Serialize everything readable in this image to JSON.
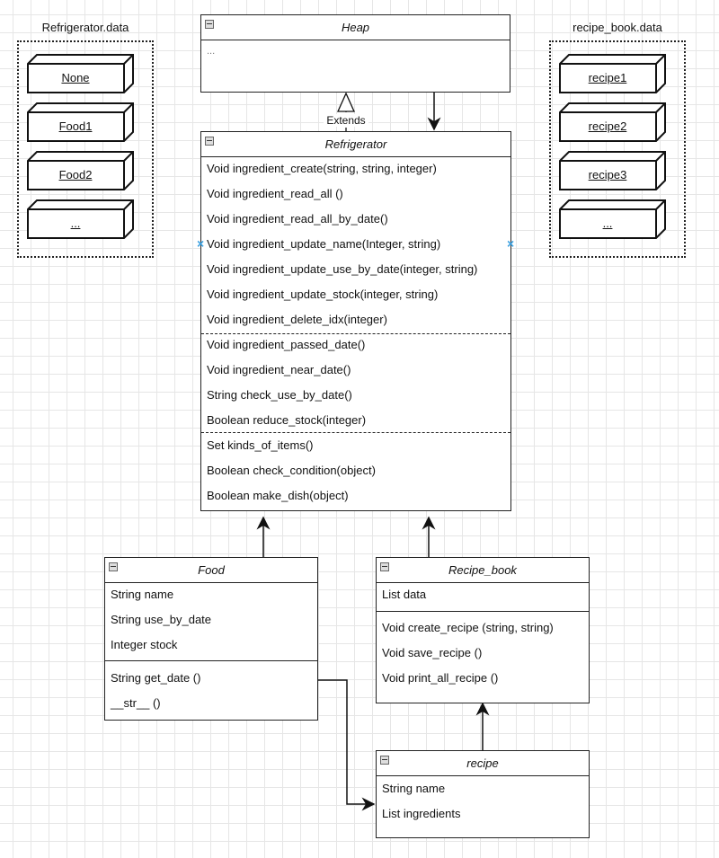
{
  "stores": [
    {
      "label": "Refrigerator.data",
      "items": [
        "None",
        "Food1",
        "Food2",
        "..."
      ]
    },
    {
      "label": "recipe_book.data",
      "items": [
        "recipe1",
        "recipe2",
        "recipe3",
        "..."
      ]
    }
  ],
  "classes": {
    "heap": {
      "name": "Heap",
      "rows": [
        "..."
      ]
    },
    "refrigerator": {
      "name": "Refrigerator",
      "group1": [
        "Void ingredient_create(string, string, integer)",
        "Void ingredient_read_all ()",
        "Void ingredient_read_all_by_date()",
        "Void ingredient_update_name(Integer, string)",
        "Void ingredient_update_use_by_date(integer, string)",
        "Void ingredient_update_stock(integer, string)",
        "Void ingredient_delete_idx(integer)"
      ],
      "group2": [
        "Void ingredient_passed_date()",
        "Void ingredient_near_date()",
        "String check_use_by_date()",
        "Boolean reduce_stock(integer)"
      ],
      "group3": [
        "Set kinds_of_items()",
        "Boolean check_condition(object)",
        "Boolean make_dish(object)"
      ]
    },
    "food": {
      "name": "Food",
      "attributes": [
        "String name",
        "String use_by_date",
        "Integer stock"
      ],
      "methods": [
        "String get_date ()",
        "__str__ ()"
      ]
    },
    "recipe_book": {
      "name": "Recipe_book",
      "attributes": [
        "List data"
      ],
      "methods": [
        "Void create_recipe (string, string)",
        "Void save_recipe ()",
        "Void print_all_recipe ()"
      ]
    },
    "recipe": {
      "name": "recipe",
      "attributes": [
        "String name",
        "List ingredients"
      ]
    }
  },
  "edges": {
    "extends_label": "Extends"
  }
}
